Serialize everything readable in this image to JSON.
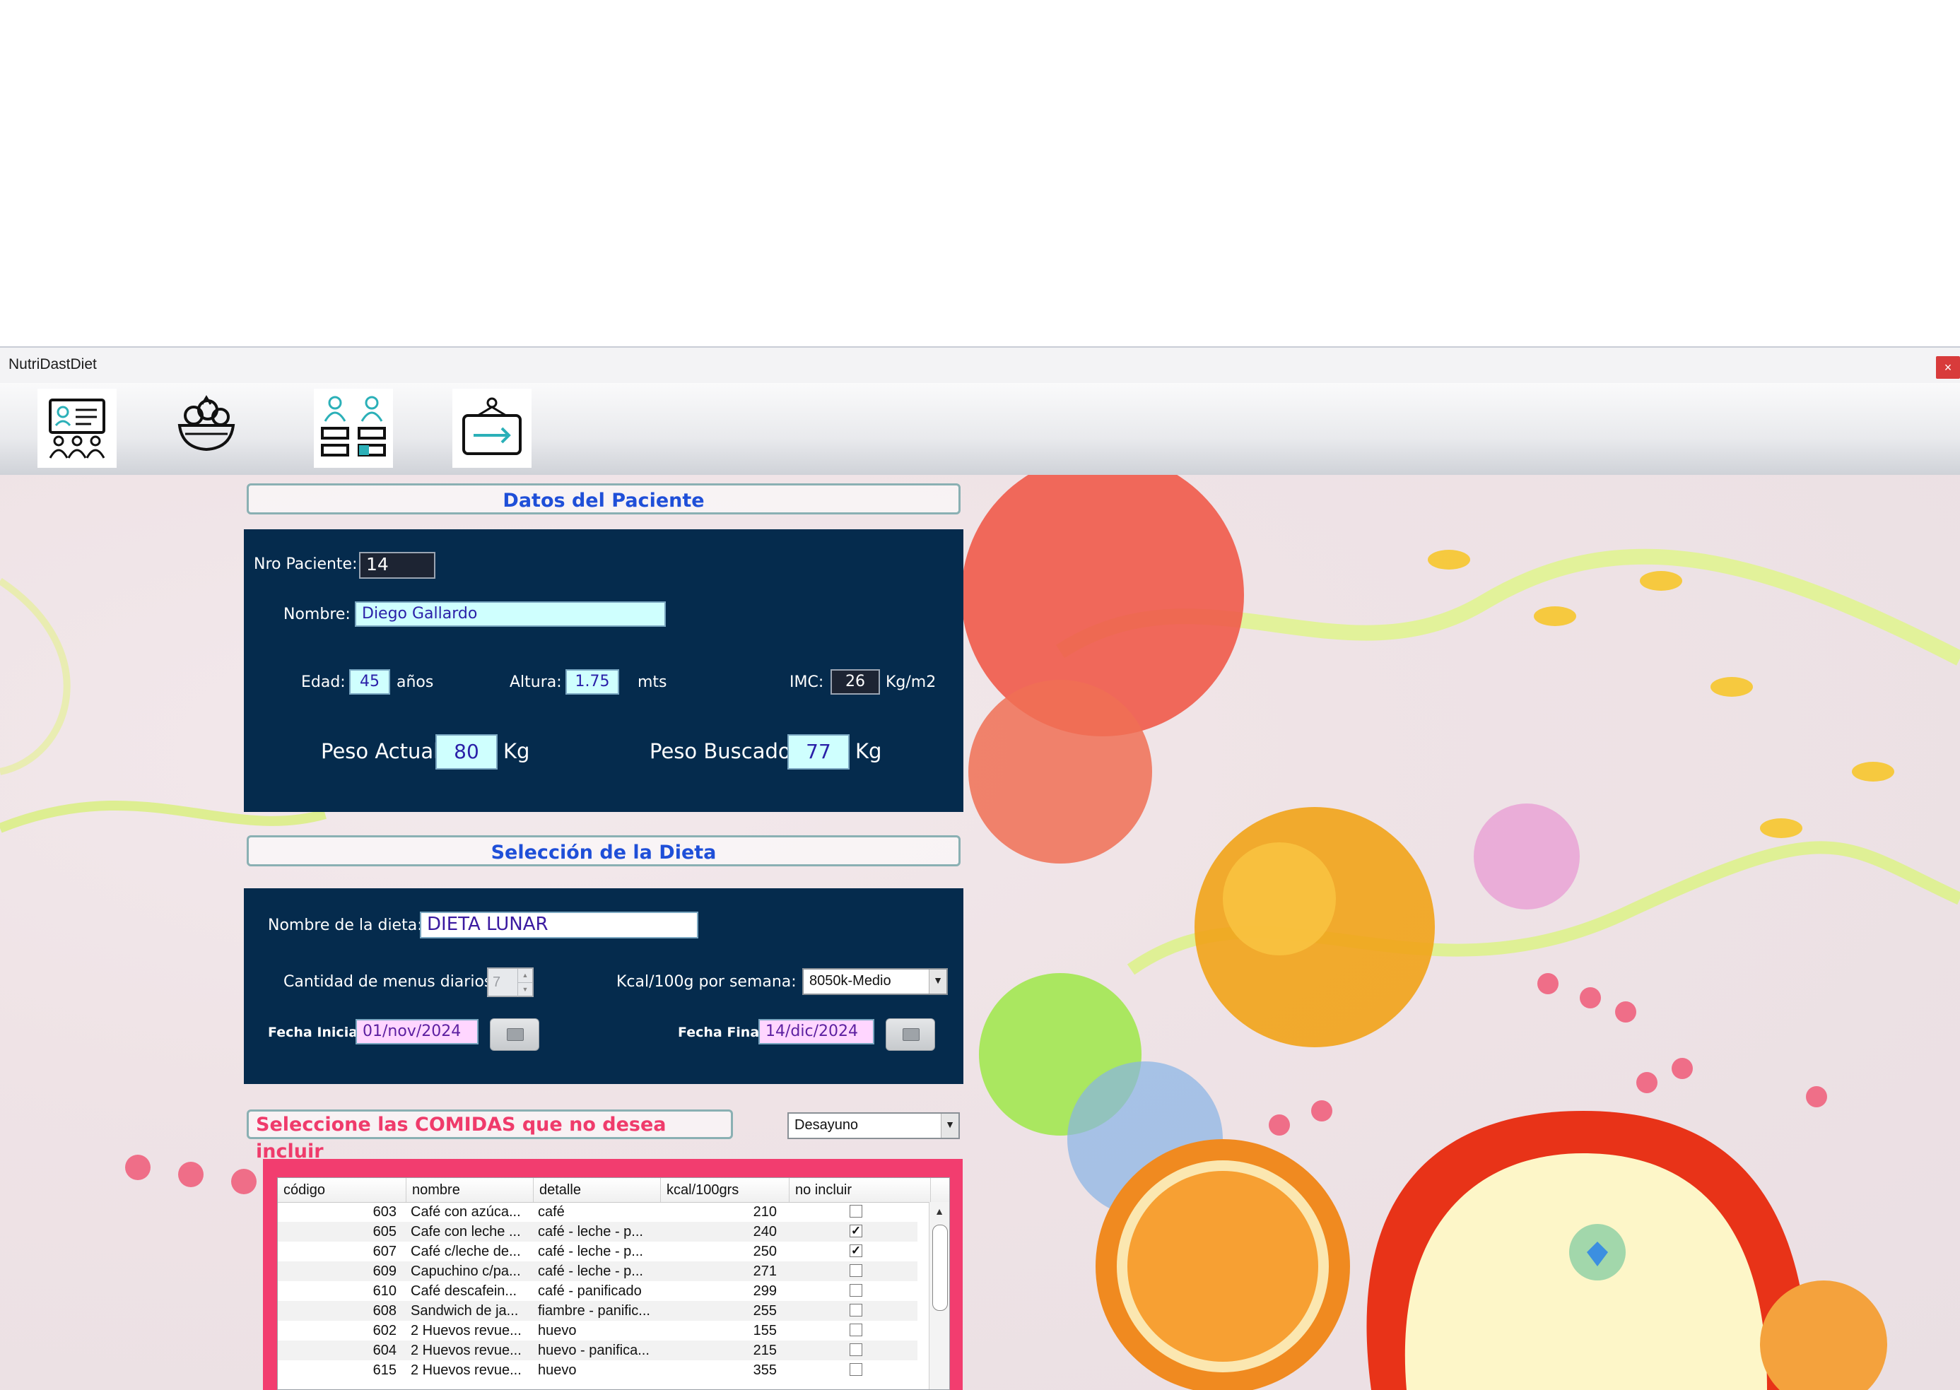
{
  "window": {
    "title": "NutriDastDiet",
    "close_label": "×"
  },
  "toolbar": {
    "buttons": [
      {
        "icon": "patient-card-icon"
      },
      {
        "icon": "salad-bowl-icon"
      },
      {
        "icon": "patients-list-icon"
      },
      {
        "icon": "exit-sign-icon"
      }
    ]
  },
  "patient": {
    "section_title": "Datos del Paciente",
    "nro_label": "Nro Paciente:",
    "nro_value": "14",
    "nombre_label": "Nombre:",
    "nombre_value": "Diego Gallardo",
    "edad_label": "Edad:",
    "edad_value": "45",
    "edad_unit": "años",
    "altura_label": "Altura:",
    "altura_value": "1.75",
    "altura_unit": "mts",
    "imc_label": "IMC:",
    "imc_value": "26",
    "imc_unit": "Kg/m2",
    "peso_actual_label": "Peso Actual:",
    "peso_actual_value": "80",
    "peso_actual_unit": "Kg",
    "peso_buscado_label": "Peso Buscado:",
    "peso_buscado_value": "77",
    "peso_buscado_unit": "Kg"
  },
  "diet": {
    "section_title": "Selección de la Dieta",
    "nombre_label": "Nombre de la dieta:",
    "nombre_value": "DIETA LUNAR",
    "menus_label": "Cantidad de menus diarios:",
    "menus_value": "7",
    "kcal_label": "Kcal/100g por semana:",
    "kcal_value": "8050k-Medio",
    "fecha_inicial_label": "Fecha Inicial:",
    "fecha_inicial_value": "01/nov/2024",
    "fecha_final_label": "Fecha Final:",
    "fecha_final_value": "14/dic/2024"
  },
  "foods": {
    "section_title": "Seleccione las COMIDAS que no desea incluir",
    "meal_value": "Desayuno",
    "columns": [
      "código",
      "nombre",
      "detalle",
      "kcal/100grs",
      "no incluir"
    ],
    "rows": [
      {
        "codigo": "603",
        "nombre": "Café con azúca...",
        "detalle": "café",
        "kcal": "210",
        "excluded": false
      },
      {
        "codigo": "605",
        "nombre": "Cafe con leche ...",
        "detalle": "café - leche - p...",
        "kcal": "240",
        "excluded": true
      },
      {
        "codigo": "607",
        "nombre": "Café c/leche de...",
        "detalle": "café - leche - p...",
        "kcal": "250",
        "excluded": true
      },
      {
        "codigo": "609",
        "nombre": "Capuchino c/pa...",
        "detalle": "café - leche - p...",
        "kcal": "271",
        "excluded": false
      },
      {
        "codigo": "610",
        "nombre": "Café descafein...",
        "detalle": "café - panificado",
        "kcal": "299",
        "excluded": false
      },
      {
        "codigo": "608",
        "nombre": "Sandwich de ja...",
        "detalle": "fiambre - panific...",
        "kcal": "255",
        "excluded": false
      },
      {
        "codigo": "602",
        "nombre": "2 Huevos revue...",
        "detalle": "huevo",
        "kcal": "155",
        "excluded": false
      },
      {
        "codigo": "604",
        "nombre": "2 Huevos revue...",
        "detalle": "huevo - panifica...",
        "kcal": "215",
        "excluded": false
      },
      {
        "codigo": "615",
        "nombre": "2 Huevos revue...",
        "detalle": "huevo",
        "kcal": "355",
        "excluded": false
      }
    ]
  }
}
